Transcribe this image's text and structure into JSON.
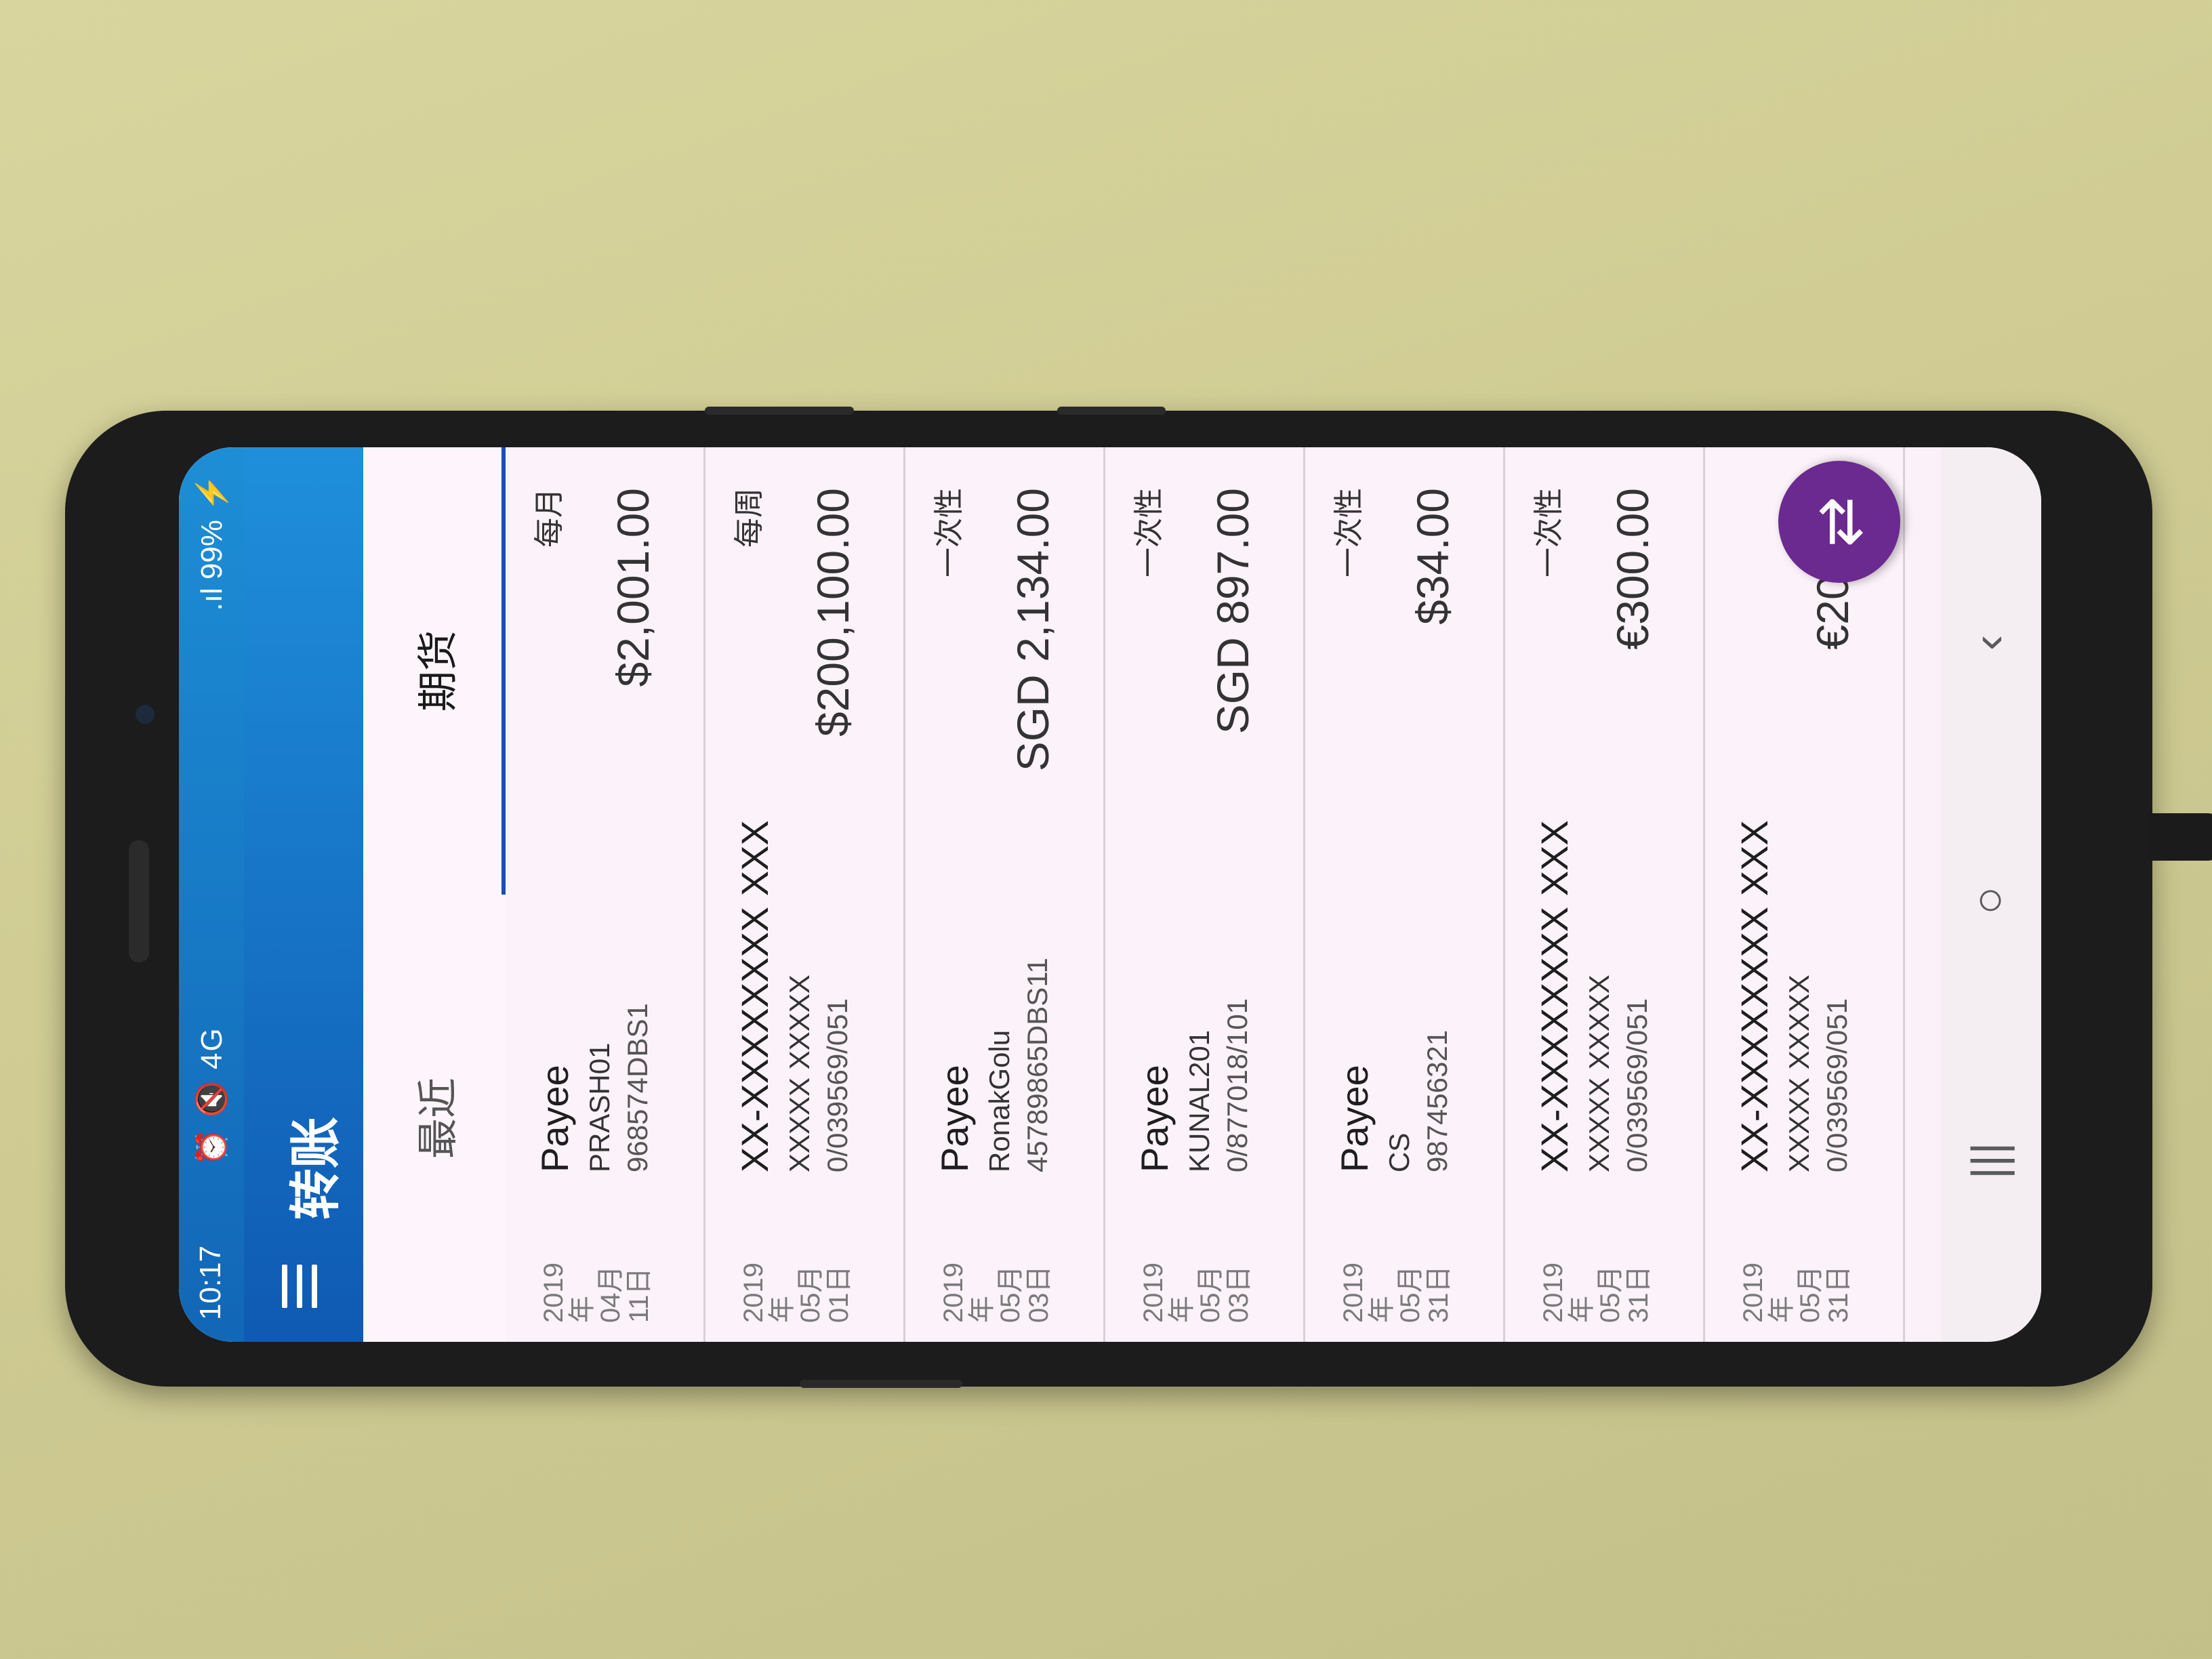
{
  "status_bar": {
    "time": "10:17",
    "icons": "⏰ 🔇 4G",
    "signal_battery": ".ıl 99% ⚡"
  },
  "app_bar": {
    "title": "转账"
  },
  "tabs": [
    {
      "label": "最近",
      "selected": false
    },
    {
      "label": "期货",
      "selected": true
    }
  ],
  "transfers": [
    {
      "date_year": "2019年",
      "date_month": "04月",
      "date_day": "11日",
      "name": "Payee",
      "line1": "PRASH01",
      "line2": "968574DBS1",
      "frequency": "每月",
      "amount": "$2,001.00"
    },
    {
      "date_year": "2019年",
      "date_month": "05月",
      "date_day": "01日",
      "name": "XX-XXXXXXXX XXX",
      "line1": "XXXXX XXXXX",
      "line2": "0/039569/051",
      "frequency": "每周",
      "amount": "$200,100.00"
    },
    {
      "date_year": "2019年",
      "date_month": "05月",
      "date_day": "03日",
      "name": "Payee",
      "line1": "RonakGolu",
      "line2": "45789865DBS11",
      "frequency": "一次性",
      "amount": "SGD 2,134.00"
    },
    {
      "date_year": "2019年",
      "date_month": "05月",
      "date_day": "03日",
      "name": "Payee",
      "line1": "KUNAL201",
      "line2": "0/877018/101",
      "frequency": "一次性",
      "amount": "SGD 897.00"
    },
    {
      "date_year": "2019年",
      "date_month": "05月",
      "date_day": "31日",
      "name": "Payee",
      "line1": "CS",
      "line2": "987456321",
      "frequency": "一次性",
      "amount": "$34.00"
    },
    {
      "date_year": "2019年",
      "date_month": "05月",
      "date_day": "31日",
      "name": "XX-XXXXXXXX XXX",
      "line1": "XXXXX XXXXX",
      "line2": "0/039569/051",
      "frequency": "一次性",
      "amount": "€300.00"
    },
    {
      "date_year": "2019年",
      "date_month": "05月",
      "date_day": "31日",
      "name": "XX-XXXXXXXX XXX",
      "line1": "XXXXX XXXXX",
      "line2": "0/039569/051",
      "frequency": "",
      "amount": "€200.00"
    }
  ],
  "fab": {
    "icon": "transfer-arrows-icon",
    "glyph": "⇄"
  },
  "nav": {
    "recents": "|||",
    "home": "○",
    "back": "‹"
  },
  "colors": {
    "header_blue": "#1267b6",
    "fab_purple": "#6b2a8f",
    "tab_indicator": "#1a4fb0"
  }
}
